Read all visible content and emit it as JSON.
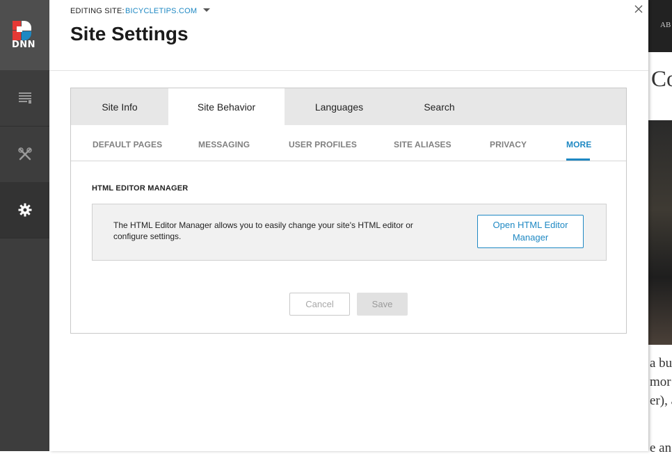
{
  "persona_bar": {
    "logo_text": "DNN",
    "items": [
      {
        "icon": "content-icon"
      },
      {
        "icon": "tools-icon"
      },
      {
        "icon": "gear-icon"
      }
    ]
  },
  "header": {
    "editing_label": "EDITING SITE:",
    "site_name": "BICYCLETIPS.COM",
    "title": "Site Settings"
  },
  "tabs": [
    {
      "label": "Site Info",
      "active": false
    },
    {
      "label": "Site Behavior",
      "active": true
    },
    {
      "label": "Languages",
      "active": false
    },
    {
      "label": "Search",
      "active": false
    }
  ],
  "subtabs": [
    {
      "label": "DEFAULT PAGES",
      "active": false
    },
    {
      "label": "MESSAGING",
      "active": false
    },
    {
      "label": "USER PROFILES",
      "active": false
    },
    {
      "label": "SITE ALIASES",
      "active": false
    },
    {
      "label": "PRIVACY",
      "active": false
    },
    {
      "label": "MORE",
      "active": true
    }
  ],
  "section": {
    "title": "HTML EDITOR MANAGER",
    "description": "The HTML Editor Manager allows you to easily change your site's HTML editor or configure settings.",
    "open_button": "Open HTML Editor Manager"
  },
  "actions": {
    "cancel": "Cancel",
    "save": "Save"
  },
  "background_site": {
    "header_fragment": "AB",
    "heading_fragment": "Co",
    "para_lines": [
      "a bu",
      "mor",
      "er), a",
      "e an"
    ]
  },
  "colors": {
    "accent": "#1e88c3",
    "persona_bar": "#3d3d3d"
  }
}
